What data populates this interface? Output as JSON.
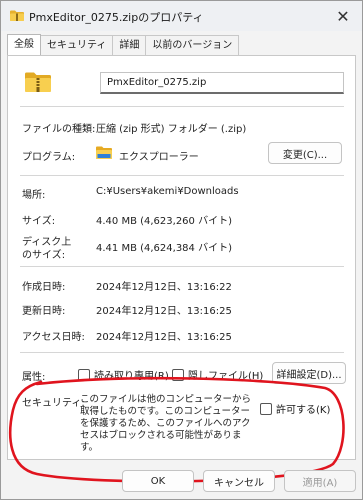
{
  "window": {
    "title": "PmxEditor_0275.zipのプロパティ",
    "close_glyph": "✕"
  },
  "tabs": [
    {
      "label": "全般",
      "active": true
    },
    {
      "label": "セキュリティ",
      "active": false
    },
    {
      "label": "詳細",
      "active": false
    },
    {
      "label": "以前のバージョン",
      "active": false
    }
  ],
  "general": {
    "filename": "PmxEditor_0275.zip",
    "file_type_label": "ファイルの種類:",
    "file_type_value": "圧縮 (zip 形式) フォルダー (.zip)",
    "program_label": "プログラム:",
    "program_value": "エクスプローラー",
    "change_button": "変更(C)...",
    "location_label": "場所:",
    "location_value": "C:¥Users¥akemi¥Downloads",
    "size_label": "サイズ:",
    "size_value": "4.40 MB (4,623,260 バイト)",
    "disk_size_label_1": "ディスク上",
    "disk_size_label_2": "のサイズ:",
    "disk_size_value": "4.41 MB (4,624,384 バイト)",
    "created_label": "作成日時:",
    "created_value": "2024年12月12日、13:16:22",
    "modified_label": "更新日時:",
    "modified_value": "2024年12月12日、13:16:25",
    "accessed_label": "アクセス日時:",
    "accessed_value": "2024年12月12日、13:16:25",
    "attributes_label": "属性:",
    "readonly_label": "読み取り専用(R)",
    "hidden_label": "隠しファイル(H)",
    "advanced_button": "詳細設定(D)...",
    "security_label": "セキュリティ:",
    "security_text": "このファイルは他のコンピューターから取得したものです。このコンピューターを保護するため、このファイルへのアクセスはブロックされる可能性があります。",
    "unblock_label": "許可する(K)"
  },
  "footer": {
    "ok": "OK",
    "cancel": "キャンセル",
    "apply": "適用(A)"
  },
  "colors": {
    "annotation_red": "#e0141e",
    "folder_yellow": "#f5c542",
    "folder_dark": "#d9a21b"
  }
}
